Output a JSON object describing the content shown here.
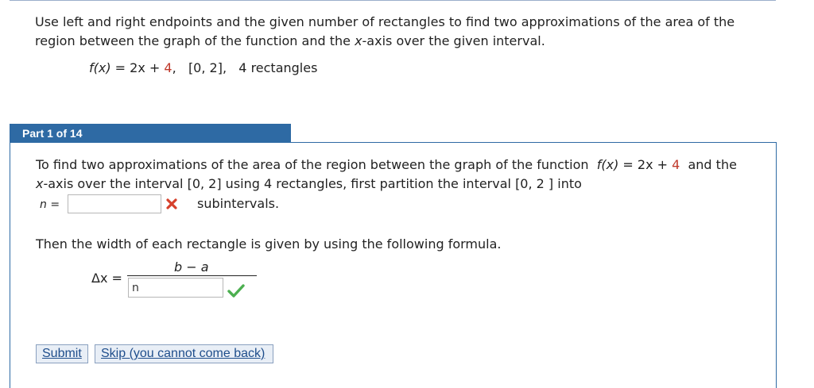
{
  "problem": {
    "prompt_line1": "Use left and right endpoints and the given number of rectangles to find two approximations of the area of the",
    "prompt_line2_a": "region between the graph of the function and the ",
    "prompt_line2_x": "x",
    "prompt_line2_b": "-axis over the given interval.",
    "given_fx": "f(x)",
    "given_eq": " = 2x + ",
    "given_const": "4",
    "given_rest": ",   [0, 2],   4 rectangles"
  },
  "part": {
    "label": "Part 1 of 14"
  },
  "instruction": {
    "line1_a": "To find two approximations of the area of the region between the graph of the function  ",
    "line1_fx": "f(x)",
    "line1_eq": " = 2x + ",
    "line1_const": "4",
    "line1_b": "  and the",
    "line2_x": "x",
    "line2_rest": "-axis over the interval [0, 2] using 4 rectangles, first partition the interval [0, 2 ] into",
    "n_label": "n =",
    "n_value": "",
    "subintervals": "subintervals."
  },
  "width": {
    "text": "Then the width of each rectangle is given by using the following formula.",
    "delta_label": "Δx =",
    "numerator": "b − a",
    "denominator_value": "n"
  },
  "icons": {
    "incorrect": "x-mark-icon",
    "correct": "checkmark-icon"
  },
  "colors": {
    "incorrect": "#d6402b",
    "correct": "#4caf50",
    "accent": "#2e6aa4"
  },
  "buttons": {
    "submit": "Submit",
    "skip": "Skip (you cannot come back)"
  }
}
